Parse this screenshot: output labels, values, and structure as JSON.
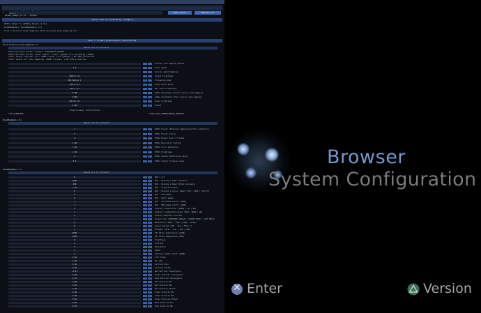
{
  "editor": {
    "menubar": "File  Edit  Settings  Debug  Help  ReShade",
    "title": "RTPGI_Adapt_v1.fx - Editor",
    "search_placeholder": "Search",
    "btn_save": "Save to Fx",
    "btn_reload": "Reload All",
    "header_presets": "Three rows of effects by category",
    "effects": [
      "RTPGI_Adapt.fx [RTPGI_Adapt_v1.fx]",
      "DoomMapRemix [DoomMapRemix.fx]",
      "Tilt's Inverse tone mapping [Tilt_Inverse_Tone_mapping.fx]"
    ],
    "header_sections": "Unit / Global preprocessor definitions",
    "section1": "Tilt_Inverse_Tone_mapping.fx",
    "section1_sub": "Reset all to default",
    "section1_info": [
      "Detected base buffer format:      R10G10B10_UNORM",
      "Detected base buffer color space: linear (gamma 2.2) encoding (sRGB)",
      "Color space transfer for: sRGB   linear (2.2 gamma) + BT.709 primaries",
      "Color space for tone mapping:     sRGB (linear) + BT.709 primaries"
    ],
    "section1_rows": [
      {
        "value": "",
        "label": "Inverse tone mapping method"
      },
      {
        "value": "1.0",
        "label": "Input gamma"
      },
      {
        "value": "",
        "label": "Inverse gamut mapping"
      },
      {
        "value": "1000.0 nit",
        "label": "Target brightness"
      },
      {
        "value": "HDR Method 1",
        "label": "Processing mode"
      },
      {
        "value": "100.0 nit",
        "label": "Input white point"
      },
      {
        "value": "100.0 nit",
        "label": "Max input brightness"
      },
      {
        "value": "0.100",
        "label": "Gamma adjustment before inverse tone mapping"
      },
      {
        "value": "0.000",
        "label": "Gamma adjustment after inverse tone mapping"
      },
      {
        "value": "100.00 nit",
        "label": "Input brightness"
      },
      {
        "value": "0.000",
        "label": "Global"
      }
    ],
    "preproc_label": "Preprocessor definitions",
    "preproc_items": [
      "CSP_OVERRIDE",
      "TILDE_INV_TONEMAPPING_METHOD"
    ],
    "section2": "DoomMapRemix.fx",
    "section2_sub": "Reset all to default",
    "section2_rows": [
      {
        "value": "1",
        "label": "RTPGI Preset (Enhanced Temperature More Authentic)"
      },
      {
        "value": "0",
        "label": "RTPGI Preset Tuning"
      },
      {
        "value": "0",
        "label": "RTPGI Mosaic Tone 1 3 Phase"
      },
      {
        "value": "1.00",
        "label": "RTPGI Resolution Setting"
      },
      {
        "value": "1.00",
        "label": "RTPGI Color Saturation"
      },
      {
        "value": "1.00",
        "label": "RTPGI Brightness"
      },
      {
        "value": "0",
        "label": "RTPGI Custom Posterizing value"
      },
      {
        "value": "0.5",
        "label": "RTPGI Custom Fringing value"
      }
    ],
    "section3": "DoomMapRemix.fx",
    "section3_sub": "Reset all to default",
    "section3_rows": [
      {
        "value": "0",
        "label": "SDR 1 nit"
      },
      {
        "value": "1000",
        "label": "SDR - Display's Peak Luminance"
      },
      {
        "value": "200",
        "label": "SDR - Display's Paper White Luminance"
      },
      {
        "value": "1.00",
        "label": "SDR - Original/Custom"
      },
      {
        "value": "0",
        "label": "SDR - Display's Colour Gamut (709 | 2020 | DCI-P3)"
      },
      {
        "value": "0",
        "label": "SDR - CTM Gamma"
      },
      {
        "value": "0",
        "label": "SDR - PQ/ST Gamma"
      },
      {
        "value": "1",
        "label": "SDR - CTM Gamma Cutoff (sRGB)"
      },
      {
        "value": "1",
        "label": "SDR - HDR Gamma Cutoff (sRGB)"
      },
      {
        "value": "1",
        "label": "Display's Resolution (1080p | 4K | 8K)"
      },
      {
        "value": "1",
        "label": "Display's Supported Layout (RGB | BGRG | QD)"
      },
      {
        "value": "0",
        "label": "Display Subpixel Accurate"
      },
      {
        "value": "1",
        "label": "Screen Type (APERTURE GRILLE | SHADOW MASK | SLOT MASK)"
      },
      {
        "value": "0",
        "label": "Resolution (480p | 240p | 288p | 576p)"
      },
      {
        "value": "0",
        "label": "Colour System (709 | PAL | NTSC-J)"
      },
      {
        "value": "0",
        "label": "Phosphor (NTSC | PAL | P22 | EBU)"
      },
      {
        "value": "6500",
        "label": "CRT White Temperature (sRGB)"
      },
      {
        "value": "6500",
        "label": "CRT White Temperature (SDR)"
      },
      {
        "value": "0",
        "label": "Brightness"
      },
      {
        "value": "0",
        "label": "Contrast"
      },
      {
        "value": "0",
        "label": "Saturation"
      },
      {
        "value": "0",
        "label": "Gamma"
      },
      {
        "value": "1",
        "label": "Scanline Gamma Cutoff (sRGB)"
      },
      {
        "value": "0.00",
        "label": "Fill Flash"
      },
      {
        "value": "1.00",
        "label": "Min Amp"
      },
      {
        "value": "0.50",
        "label": "Vertical Blur"
      },
      {
        "value": "0.00",
        "label": "Vertical Anchor"
      },
      {
        "value": "-0.33",
        "label": "Red Vertical Convergence"
      },
      {
        "value": "0.00",
        "label": "Green Vertical Convergence"
      },
      {
        "value": "0.33",
        "label": "Blue Vertical Convergence"
      },
      {
        "value": "0.00",
        "label": "Red Scanline Min"
      },
      {
        "value": "0.00",
        "label": "Red Scanline Max"
      },
      {
        "value": "0.00",
        "label": "Red Scanline Attack"
      },
      {
        "value": "0.00",
        "label": "Green Scanline Min"
      },
      {
        "value": "0.00",
        "label": "Green Scanline Max"
      },
      {
        "value": "0.00",
        "label": "Green Scanline Attack"
      },
      {
        "value": "0.00",
        "label": "Blue Scanline Min"
      },
      {
        "value": "0.00",
        "label": "Blue Scanline Max"
      }
    ]
  },
  "ps2": {
    "title": "Browser",
    "subtitle": "System Configuration",
    "enter_label": "Enter",
    "version_label": "Version",
    "accent_color": "#6e9ad0"
  }
}
